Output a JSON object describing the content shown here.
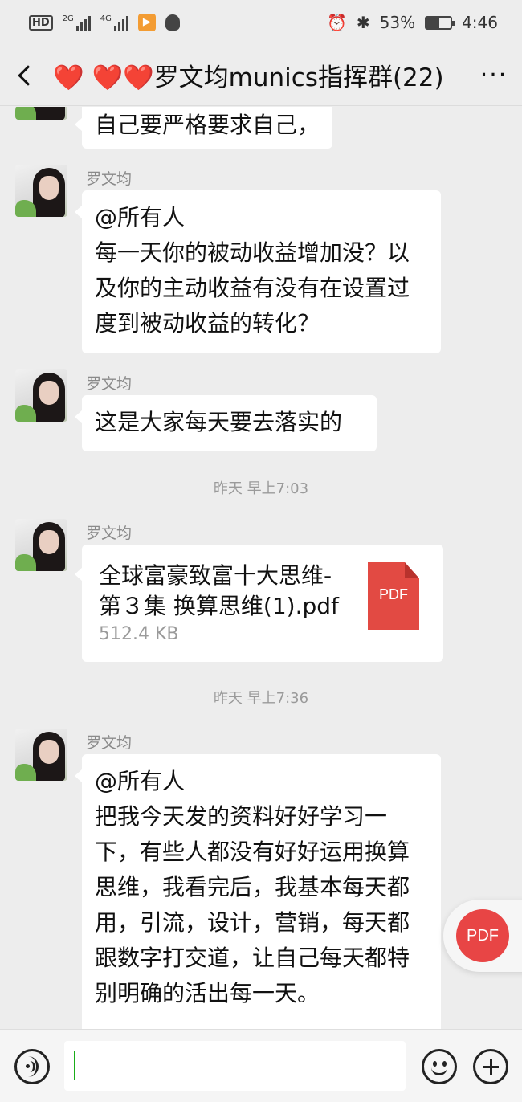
{
  "status_bar": {
    "hd": "HD",
    "net1": "2G",
    "net2": "4G",
    "battery": "53%",
    "time": "4:46"
  },
  "header": {
    "title": "❤️ ❤️❤️罗文均munics指挥群(22)",
    "more": "···"
  },
  "messages": [
    {
      "sender": "",
      "lines": [
        "自己要严格要求自己，"
      ]
    },
    {
      "sender": "罗文均",
      "lines": [
        "@所有人",
        "每一天你的被动收益增加没？以",
        "及你的主动收益有没有在设置过",
        "度到被动收益的转化？"
      ]
    },
    {
      "sender": "罗文均",
      "lines": [
        "这是大家每天要去落实的"
      ]
    },
    {
      "sender": "罗文均",
      "file": {
        "name_lines": [
          "全球富豪致富十大思维-",
          "第３集 换算思维(1).pdf"
        ],
        "size": "512.4 KB",
        "icon_label": "PDF"
      }
    },
    {
      "sender": "罗文均",
      "lines": [
        "@所有人",
        "把我今天发的资料好好学习一",
        "下，有些人都没有好好运用换算",
        "思维，我看完后，我基本每天都",
        "用，引流，设计，营销，每天都",
        "跟数字打交道，让自己每天都特",
        "别明确的活出每一天。"
      ]
    }
  ],
  "timestamps": [
    "昨天 早上7:03",
    "昨天 早上7:36"
  ],
  "floating_button": {
    "label": "PDF"
  },
  "accent_colors": {
    "pdf": "#e84545",
    "caret": "#1aad19"
  }
}
